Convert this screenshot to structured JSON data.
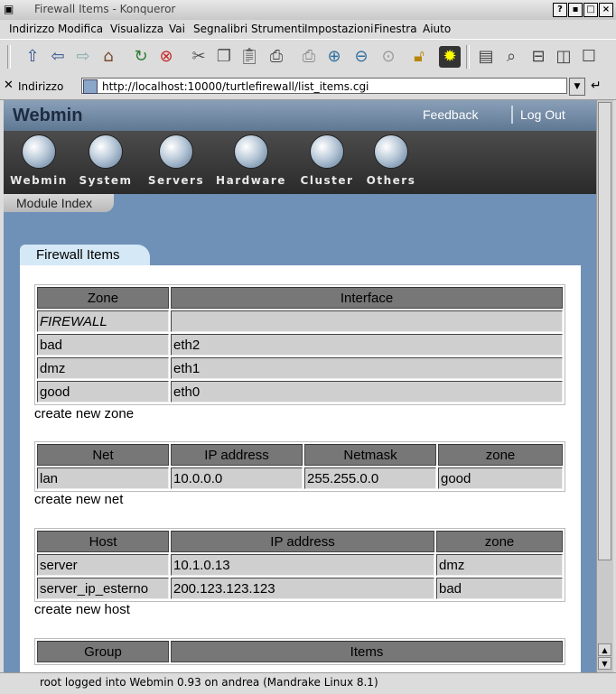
{
  "window": {
    "title": "Firewall Items - Konqueror",
    "btn_help": "?",
    "btn_min": "▪",
    "btn_max": "□",
    "btn_close": "×"
  },
  "menu": [
    "Indirizzo",
    "Modifica",
    "Visualizza",
    "Vai",
    "Segnalibri",
    "Strumenti",
    "Impostazioni",
    "Finestra",
    "Aiuto"
  ],
  "location": {
    "label": "Indirizzo",
    "url": "http://localhost:10000/turtlefirewall/list_items.cgi"
  },
  "webmin": {
    "logo": "Webmin",
    "feedback": "Feedback",
    "logout": "Log Out",
    "categories": [
      "Webmin",
      "System",
      "Servers",
      "Hardware",
      "Cluster",
      "Others"
    ],
    "module_index": "Module Index"
  },
  "page": {
    "tab_title": "Firewall Items",
    "zones": {
      "headers": [
        "Zone",
        "Interface"
      ],
      "rows": [
        [
          "FIREWALL",
          ""
        ],
        [
          "bad",
          "eth2"
        ],
        [
          "dmz",
          "eth1"
        ],
        [
          "good",
          "eth0"
        ]
      ],
      "create_link": "create new zone"
    },
    "nets": {
      "headers": [
        "Net",
        "IP address",
        "Netmask",
        "zone"
      ],
      "rows": [
        [
          "lan",
          "10.0.0.0",
          "255.255.0.0",
          "good"
        ]
      ],
      "create_link": "create new net"
    },
    "hosts": {
      "headers": [
        "Host",
        "IP address",
        "zone"
      ],
      "rows": [
        [
          "server",
          "10.1.0.13",
          "dmz"
        ],
        [
          "server_ip_esterno",
          "200.123.123.123",
          "bad"
        ]
      ],
      "create_link": "create new host"
    },
    "groups": {
      "headers": [
        "Group",
        "Items"
      ]
    }
  },
  "status": "root logged into Webmin 0.93 on andrea (Mandrake Linux 8.1)"
}
